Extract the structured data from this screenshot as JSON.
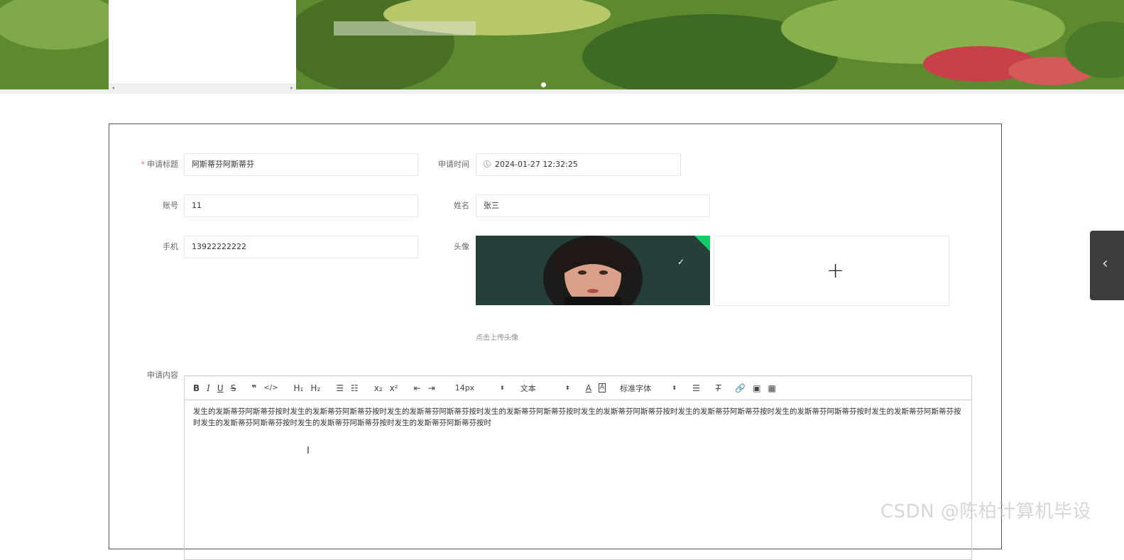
{
  "form": {
    "title_label": "申请标题",
    "title_required_mark": "*",
    "title_value": "阿斯蒂芬阿斯蒂芬",
    "time_label": "申请时间",
    "time_value": "2024-01-27 12:32:25",
    "account_label": "账号",
    "account_value": "11",
    "name_label": "姓名",
    "name_value": "张三",
    "phone_label": "手机",
    "phone_value": "13922222222",
    "avatar_label": "头像",
    "upload_tip": "点击上传头像",
    "content_label": "申请内容"
  },
  "editor": {
    "font_size": "14px",
    "text_style": "文本",
    "font_family": "标准字体",
    "content": "发生的发斯蒂芬阿斯蒂芬按时发生的发斯蒂芬阿斯蒂芬按时发生的发斯蒂芬阿斯蒂芬按时发生的发斯蒂芬阿斯蒂芬按时发生的发斯蒂芬阿斯蒂芬按时发生的发斯蒂芬阿斯蒂芬按时发生的发斯蒂芬阿斯蒂芬按时发生的发斯蒂芬阿斯蒂芬按时发生的发斯蒂芬阿斯蒂芬按时发生的发斯蒂芬阿斯蒂芬按时发生的发斯蒂芬阿斯蒂芬按时"
  },
  "watermark": "CSDN @陈柏计算机毕设",
  "colors": {
    "required": "#f56c6c",
    "upload_success": "#13ce66"
  }
}
